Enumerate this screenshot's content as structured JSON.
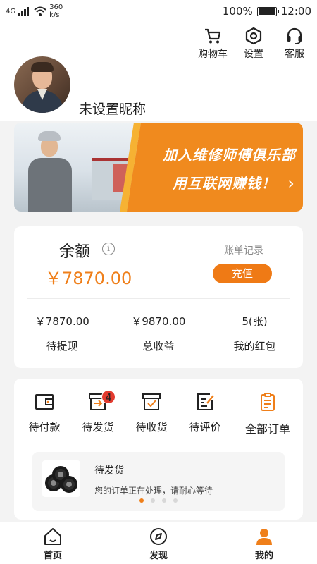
{
  "status_bar": {
    "network": "4G",
    "speed_value": "360",
    "speed_unit": "k/s",
    "battery": "100%",
    "time": "12:00",
    "battery_level": 1.0
  },
  "top_actions": [
    {
      "label": "购物车",
      "icon": "cart-icon"
    },
    {
      "label": "设置",
      "icon": "settings-icon"
    },
    {
      "label": "客服",
      "icon": "headset-icon"
    }
  ],
  "profile": {
    "nickname": "未设置昵称"
  },
  "banner": {
    "line1": "加入维修师傅俱乐部",
    "line2": "用互联网赚钱！",
    "arrow": "›"
  },
  "balance": {
    "label": "余额",
    "info": "i",
    "amount": "￥7870.00",
    "bill_link": "账单记录",
    "recharge": "充值",
    "stats": [
      {
        "value": "￥7870.00",
        "label": "待提现"
      },
      {
        "value": "￥9870.00",
        "label": "总收益"
      },
      {
        "value": "5(张)",
        "label": "我的红包"
      }
    ]
  },
  "orders": {
    "items": [
      {
        "label": "待付款",
        "icon": "wallet-icon"
      },
      {
        "label": "待发货",
        "icon": "ship-box-icon",
        "badge": "4"
      },
      {
        "label": "待收货",
        "icon": "receive-box-icon"
      },
      {
        "label": "待评价",
        "icon": "review-icon"
      },
      {
        "label": "全部订单",
        "icon": "clipboard-icon"
      }
    ],
    "panel": {
      "title": "待发货",
      "desc": "您的订单正在处理，请耐心等待"
    },
    "carousel_dots": 4,
    "active_dot": 1
  },
  "tabbar": [
    {
      "label": "首页",
      "icon": "home-icon"
    },
    {
      "label": "发现",
      "icon": "discover-icon"
    },
    {
      "label": "我的",
      "icon": "user-icon",
      "active": true
    }
  ],
  "colors": {
    "accent": "#ef7f1a",
    "badge": "#e33b2f"
  }
}
